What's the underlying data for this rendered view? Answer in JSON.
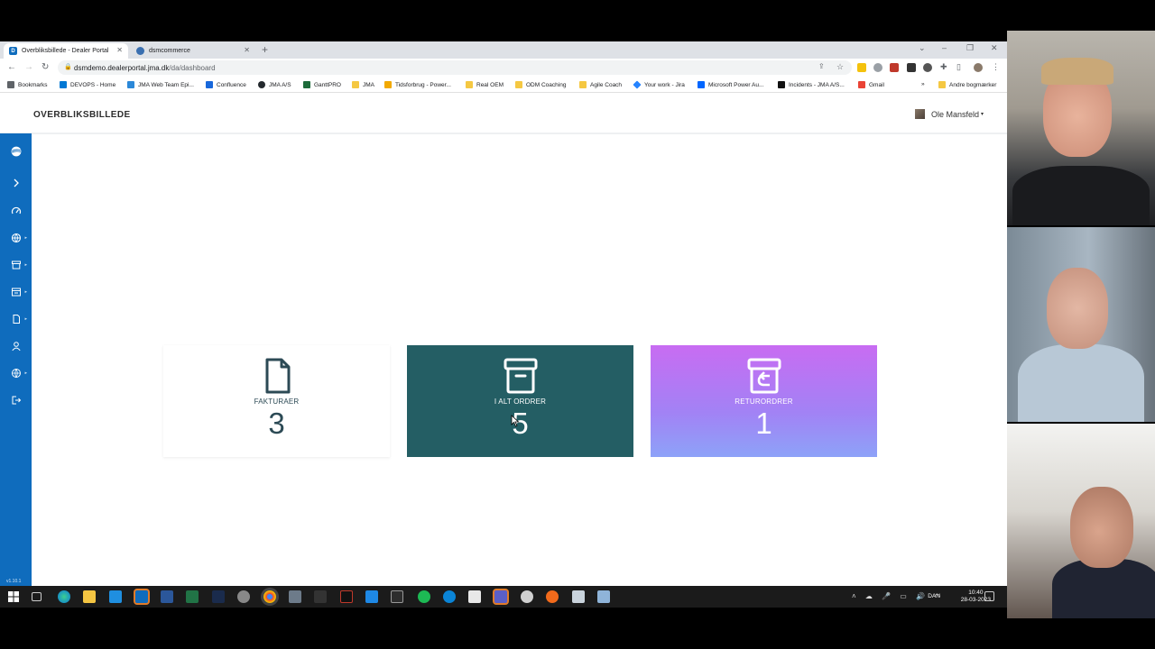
{
  "browser": {
    "tabs": [
      {
        "title": "Overbliksbillede - Dealer Portal",
        "active": true
      },
      {
        "title": "dsmcommerce",
        "active": false
      }
    ],
    "url_host": "dsmdemo.dealerportal.jma.dk",
    "url_path": "/da/dashboard",
    "bookmarks": [
      "Bookmarks",
      "DEVOPS - Home",
      "JMA Web Team Epi...",
      "Confluence",
      "JMA A/S",
      "GanttPRO",
      "JMA",
      "Tidsforbrug - Power...",
      "Real OEM",
      "ODM Coaching",
      "Agile Coach",
      "Your work - Jira",
      "Microsoft Power Au...",
      "Incidents - JMA A/S...",
      "Gmail"
    ],
    "bookmarks_more": "»",
    "other_bookmarks": "Andre bogmærker"
  },
  "app": {
    "page_title": "OVERBLIKSBILLEDE",
    "user_name": "Ole Mansfeld",
    "version": "v1.10.1",
    "cards": [
      {
        "label": "FAKTURAER",
        "value": "3",
        "icon": "file-icon"
      },
      {
        "label": "I ALT ORDRER",
        "value": "5",
        "icon": "archive-box-icon"
      },
      {
        "label": "RETURORDRER",
        "value": "1",
        "icon": "archive-return-icon"
      }
    ],
    "colors": {
      "sidebar": "#0f6cbd",
      "orders_card": "#245e64",
      "returns_gradient_top": "#c86cf2",
      "returns_gradient_bottom": "#8da2f8"
    }
  },
  "taskbar": {
    "language": "DAN",
    "time": "10:40",
    "date": "28-03-2023"
  }
}
